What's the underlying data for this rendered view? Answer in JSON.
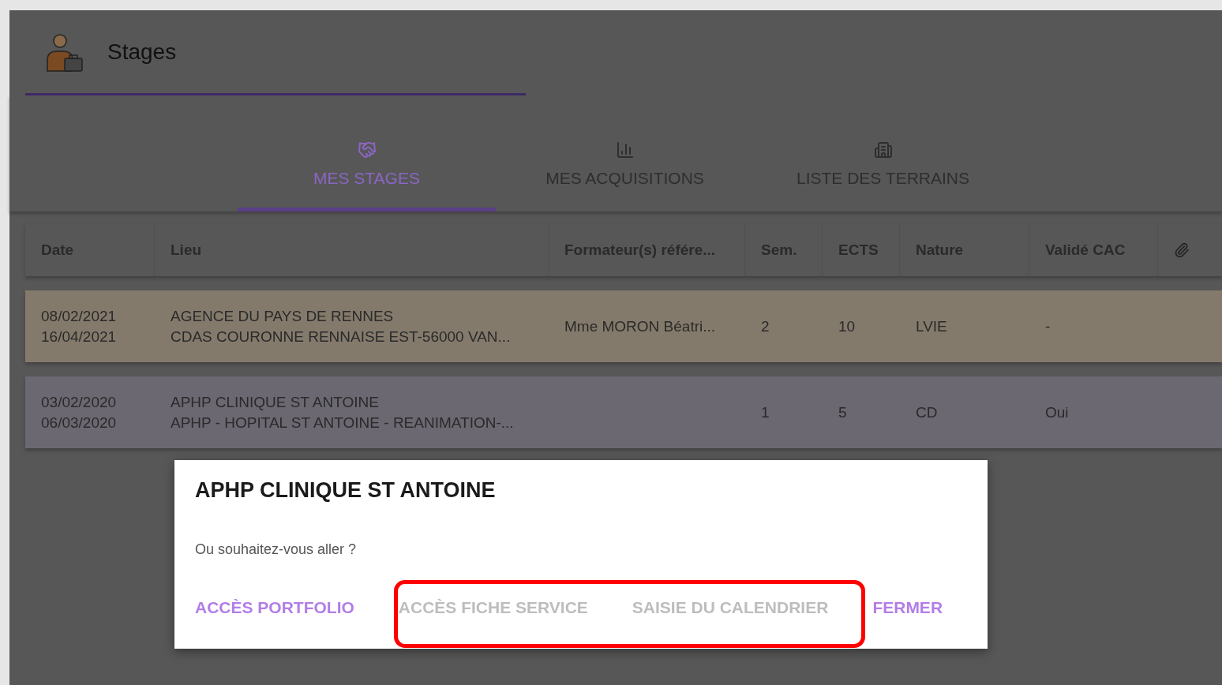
{
  "page": {
    "title": "Stages"
  },
  "tabs": [
    {
      "label": "MES STAGES",
      "kind": "handshake",
      "selected": true
    },
    {
      "label": "MES ACQUISITIONS",
      "kind": "chart",
      "selected": false
    },
    {
      "label": "LISTE DES TERRAINS",
      "kind": "building",
      "selected": false
    }
  ],
  "table": {
    "columns": [
      "Date",
      "Lieu",
      "Formateur(s) référe...",
      "Sem.",
      "ECTS",
      "Nature",
      "Validé CAC"
    ],
    "rows": [
      {
        "color": "#847a6c",
        "date": [
          "08/02/2021",
          "16/04/2021"
        ],
        "lieu": [
          "AGENCE DU PAYS DE RENNES",
          "CDAS COURONNE RENNAISE EST-56000 VAN..."
        ],
        "formateur": "Mme MORON Béatri...",
        "sem": "2",
        "ects": "10",
        "nature": "LVIE",
        "valide": "-"
      },
      {
        "color": "#6b6872",
        "date": [
          "03/02/2020",
          "06/03/2020"
        ],
        "lieu": [
          "APHP CLINIQUE ST ANTOINE",
          "APHP - HOPITAL ST ANTOINE - REANIMATION-..."
        ],
        "formateur": "",
        "sem": "1",
        "ects": "5",
        "nature": "CD",
        "valide": "Oui"
      }
    ]
  },
  "dialog": {
    "title": "APHP CLINIQUE ST ANTOINE",
    "message": "Ou souhaitez-vous aller ?",
    "buttons": [
      {
        "label": "ACCÈS PORTFOLIO",
        "disabled": false
      },
      {
        "label": "ACCÈS FICHE SERVICE",
        "disabled": true
      },
      {
        "label": "SAISIE DU CALENDRIER",
        "disabled": true
      },
      {
        "label": "FERMER",
        "disabled": false
      }
    ]
  }
}
